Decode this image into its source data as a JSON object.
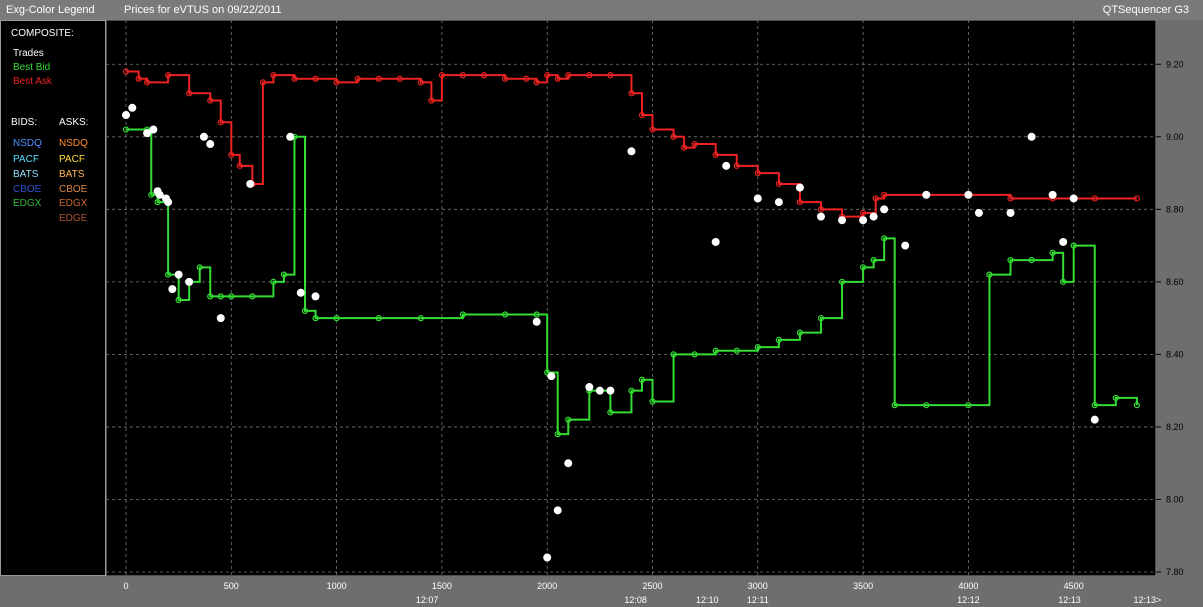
{
  "header": {
    "legend_title": "Exg-Color Legend",
    "chart_title": "Prices for  eVTUS  on  09/22/2011",
    "app_name": "QTSequencer G3"
  },
  "legend": {
    "composite_heading": "COMPOSITE:",
    "composite": [
      {
        "label": "Trades",
        "color": "#ffffff"
      },
      {
        "label": "Best Bid",
        "color": "#33dd33"
      },
      {
        "label": "Best Ask",
        "color": "#ee2222"
      }
    ],
    "bids_heading": "BIDS:",
    "asks_heading": "ASKS:",
    "bids": [
      {
        "label": "NSDQ",
        "color": "#4f8fff"
      },
      {
        "label": "PACF",
        "color": "#55ddff"
      },
      {
        "label": "BATS",
        "color": "#99ddff"
      },
      {
        "label": "CBOE",
        "color": "#3355cc"
      },
      {
        "label": "EDGX",
        "color": "#33bb33"
      }
    ],
    "asks": [
      {
        "label": "NSDQ",
        "color": "#ff8a2a"
      },
      {
        "label": "PACF",
        "color": "#ffdd33"
      },
      {
        "label": "BATS",
        "color": "#ffbb55"
      },
      {
        "label": "CBOE",
        "color": "#dd8844"
      },
      {
        "label": "EDGX",
        "color": "#cc6633"
      },
      {
        "label": "EDGE",
        "color": "#aa5533"
      }
    ]
  },
  "chart_data": {
    "type": "line",
    "ylim": [
      7.8,
      9.3
    ],
    "xlim": [
      0,
      4850
    ],
    "y_ticks": [
      "9.20",
      "9.00",
      "8.80",
      "8.60",
      "8.40",
      "8.20",
      "8.00",
      "7.80"
    ],
    "y_tick_values": [
      9.2,
      9.0,
      8.8,
      8.6,
      8.4,
      8.2,
      8.0,
      7.8
    ],
    "x_ticks": [
      "0",
      "500",
      "1000",
      "1500",
      "2000",
      "2500",
      "3000",
      "3500",
      "4000",
      "4500"
    ],
    "x_tick_values": [
      0,
      500,
      1000,
      1500,
      2000,
      2500,
      3000,
      3500,
      4000,
      4500
    ],
    "time_labels": [
      {
        "x": 1430,
        "label": "12:07"
      },
      {
        "x": 2420,
        "label": "12:08"
      },
      {
        "x": 2760,
        "label": "12:10"
      },
      {
        "x": 3000,
        "label": "12:11"
      },
      {
        "x": 4000,
        "label": "12:12"
      },
      {
        "x": 4480,
        "label": "12:13"
      },
      {
        "x": 4850,
        "label": "12:13>"
      }
    ],
    "grid": true,
    "series": [
      {
        "name": "Best Ask",
        "color": "#ee2222",
        "x": [
          0,
          60,
          100,
          200,
          300,
          400,
          450,
          500,
          540,
          600,
          650,
          700,
          800,
          900,
          1000,
          1100,
          1200,
          1300,
          1400,
          1450,
          1500,
          1600,
          1700,
          1800,
          1900,
          1950,
          2000,
          2050,
          2100,
          2200,
          2300,
          2400,
          2450,
          2500,
          2600,
          2650,
          2700,
          2800,
          2900,
          3000,
          3100,
          3200,
          3300,
          3400,
          3500,
          3560,
          3600,
          3800,
          4000,
          4200,
          4400,
          4600,
          4800
        ],
        "y": [
          9.18,
          9.16,
          9.15,
          9.17,
          9.12,
          9.1,
          9.04,
          8.95,
          8.92,
          8.87,
          9.15,
          9.17,
          9.16,
          9.16,
          9.15,
          9.16,
          9.16,
          9.16,
          9.15,
          9.1,
          9.17,
          9.17,
          9.17,
          9.16,
          9.16,
          9.15,
          9.17,
          9.16,
          9.17,
          9.17,
          9.17,
          9.12,
          9.06,
          9.02,
          9.0,
          8.97,
          8.98,
          8.95,
          8.92,
          8.9,
          8.87,
          8.82,
          8.8,
          8.78,
          8.79,
          8.83,
          8.84,
          8.84,
          8.84,
          8.83,
          8.83,
          8.83,
          8.83
        ]
      },
      {
        "name": "Best Bid",
        "color": "#33dd33",
        "x": [
          0,
          100,
          120,
          150,
          200,
          250,
          300,
          350,
          400,
          450,
          500,
          600,
          700,
          750,
          800,
          850,
          900,
          1000,
          1200,
          1400,
          1600,
          1800,
          1950,
          2000,
          2050,
          2100,
          2200,
          2300,
          2400,
          2450,
          2500,
          2600,
          2700,
          2800,
          2900,
          3000,
          3100,
          3200,
          3300,
          3400,
          3500,
          3550,
          3600,
          3650,
          3800,
          4000,
          4100,
          4200,
          4300,
          4400,
          4450,
          4500,
          4600,
          4700,
          4800
        ],
        "y": [
          9.02,
          9.02,
          8.84,
          8.82,
          8.62,
          8.55,
          8.6,
          8.64,
          8.56,
          8.56,
          8.56,
          8.56,
          8.6,
          8.62,
          9.0,
          8.52,
          8.5,
          8.5,
          8.5,
          8.5,
          8.51,
          8.51,
          8.51,
          8.35,
          8.18,
          8.22,
          8.3,
          8.24,
          8.3,
          8.33,
          8.27,
          8.4,
          8.4,
          8.41,
          8.41,
          8.42,
          8.44,
          8.46,
          8.5,
          8.6,
          8.64,
          8.66,
          8.72,
          8.26,
          8.26,
          8.26,
          8.62,
          8.66,
          8.66,
          8.68,
          8.6,
          8.7,
          8.26,
          8.28,
          8.26
        ]
      },
      {
        "name": "Trades",
        "color": "#ffffff",
        "x": [
          0,
          30,
          100,
          130,
          150,
          160,
          190,
          200,
          220,
          250,
          300,
          370,
          400,
          450,
          590,
          780,
          830,
          900,
          1950,
          2000,
          2020,
          2050,
          2100,
          2200,
          2250,
          2300,
          2400,
          2800,
          2850,
          3000,
          3100,
          3200,
          3300,
          3400,
          3500,
          3550,
          3600,
          3700,
          3800,
          4000,
          4050,
          4200,
          4300,
          4400,
          4450,
          4500,
          4600
        ],
        "y": [
          9.06,
          9.08,
          9.01,
          9.02,
          8.85,
          8.84,
          8.83,
          8.82,
          8.58,
          8.62,
          8.6,
          9.0,
          8.98,
          8.5,
          8.87,
          9.0,
          8.57,
          8.56,
          8.49,
          7.84,
          8.34,
          7.97,
          8.1,
          8.31,
          8.3,
          8.3,
          8.96,
          8.71,
          8.92,
          8.83,
          8.82,
          8.86,
          8.78,
          8.77,
          8.77,
          8.78,
          8.8,
          8.7,
          8.84,
          8.84,
          8.79,
          8.79,
          9.0,
          8.84,
          8.71,
          8.83,
          8.22
        ]
      }
    ]
  }
}
